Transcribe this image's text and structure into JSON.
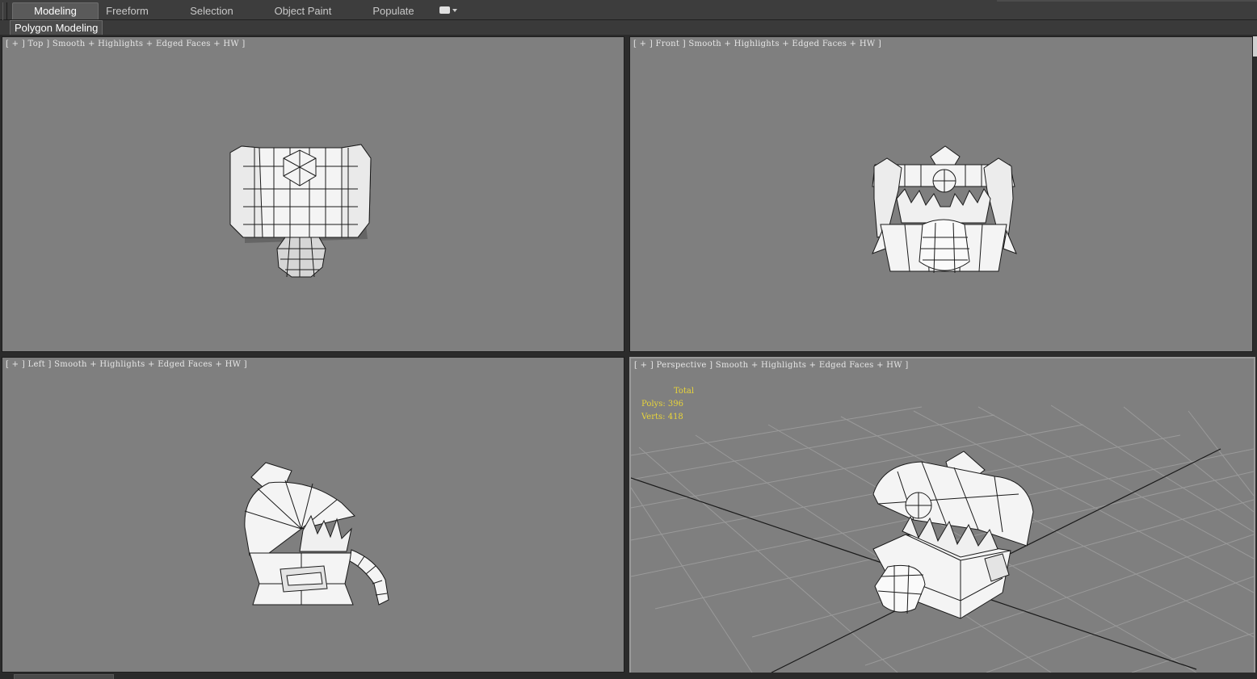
{
  "ribbon": {
    "tabs": [
      {
        "label": "Modeling",
        "active": true
      },
      {
        "label": "Freeform",
        "active": false
      },
      {
        "label": "Selection",
        "active": false
      },
      {
        "label": "Object Paint",
        "active": false
      },
      {
        "label": "Populate",
        "active": false
      }
    ],
    "dropdown_icon": "panel-dropdown-icon",
    "sub_panel_label": "Polygon Modeling"
  },
  "viewports": {
    "top": {
      "label": "[ + ] Top ] Smooth + Highlights + Edged Faces + HW ]"
    },
    "front": {
      "label": "[ + ] Front ] Smooth + Highlights + Edged Faces + HW ]"
    },
    "left": {
      "label": "[ + ] Left ] Smooth + Highlights + Edged Faces + HW ]"
    },
    "perspective": {
      "label": "[ + ] Perspective ] Smooth + Highlights + Edged Faces + HW ]"
    }
  },
  "stats": {
    "heading": "Total",
    "polys": "Polys: 396",
    "verts": "Verts: 418"
  },
  "colors": {
    "viewport_bg": "#7f7f7f",
    "ui_dark": "#3d3d3d",
    "stats_text": "#e8d43a",
    "label_text": "#e6e6e6",
    "active_viewport_border": "#9a9a9a"
  }
}
